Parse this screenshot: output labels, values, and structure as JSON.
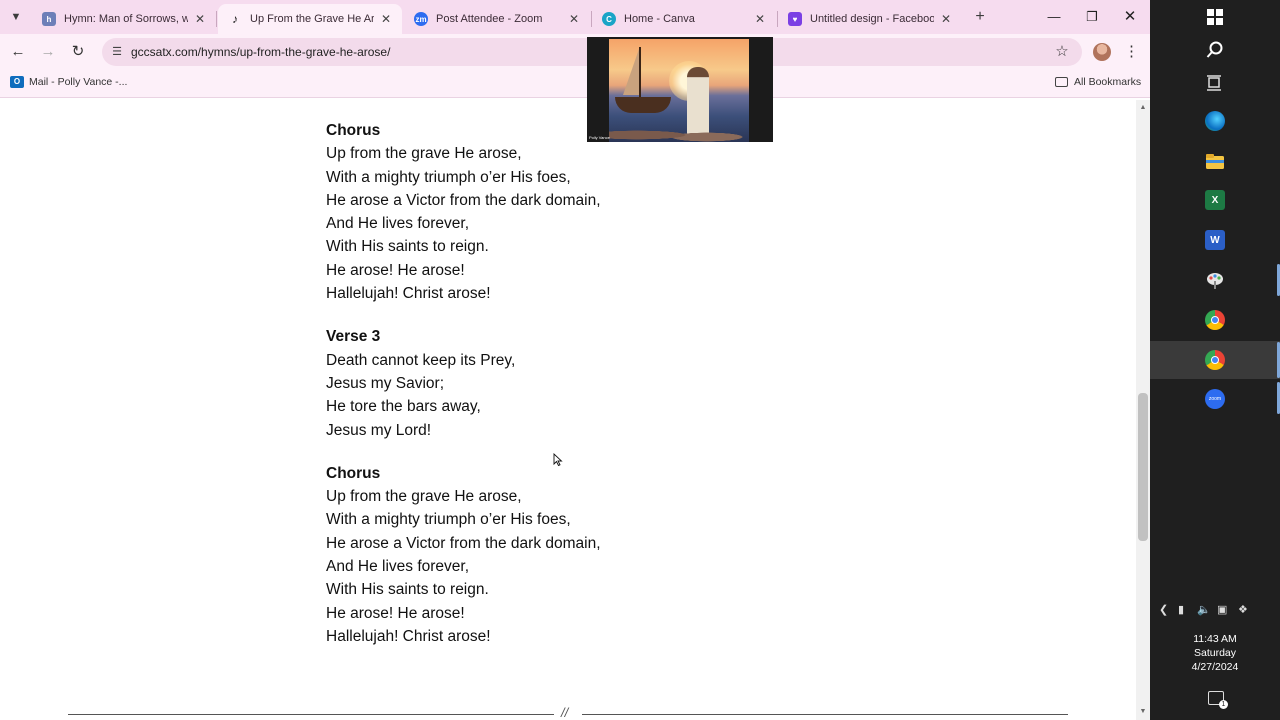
{
  "browser": {
    "tabs": [
      {
        "title": "Hymn: Man of Sorrows, what",
        "favicon": "hymnary-icon",
        "favicon_color": "#6d7fb8",
        "active": false
      },
      {
        "title": "Up From the Grave He Arose",
        "favicon": "tiktok-note-icon",
        "favicon_color": "#1a1a1a",
        "active": true
      },
      {
        "title": "Post Attendee - Zoom",
        "favicon": "zoom-icon",
        "favicon_color": "#2d6cf0",
        "active": false
      },
      {
        "title": "Home - Canva",
        "favicon": "canva-icon",
        "favicon_color": "#1aa4c7",
        "active": false
      },
      {
        "title": "Untitled design - Facebook P",
        "favicon": "canva-design-icon",
        "favicon_color": "#7b3fe4",
        "active": false
      }
    ],
    "url": "gccsatx.com/hymns/up-from-the-grave-he-arose/",
    "bookmarks": [
      {
        "label": "Mail - Polly Vance -..."
      }
    ],
    "all_bookmarks_label": "All Bookmarks"
  },
  "lyrics": [
    {
      "heading": "Chorus",
      "lines": [
        "Up from the grave He arose,",
        "With a mighty triumph o’er His foes,",
        "He arose a Victor from the dark domain,",
        "And He lives forever,",
        "With His saints to reign.",
        "He arose! He arose!",
        "Hallelujah! Christ arose!"
      ]
    },
    {
      "heading": "Verse 3",
      "lines": [
        "Death cannot keep its Prey,",
        "Jesus my Savior;",
        "He tore the bars away,",
        "Jesus my Lord!"
      ]
    },
    {
      "heading": "Chorus",
      "lines": [
        "Up from the grave He arose,",
        "With a mighty triumph o’er His foes,",
        "He arose a Victor from the dark domain,",
        "And He lives forever,",
        "With His saints to reign.",
        "He arose! He arose!",
        "Hallelujah! Christ arose!"
      ]
    }
  ],
  "divider_mark": "//",
  "zoom_video": {
    "participant_name": "Polly Vance"
  },
  "taskbar": {
    "apps": [
      "start-icon",
      "search-icon",
      "task-view-icon",
      "edge-icon",
      "file-explorer-icon",
      "excel-icon",
      "word-icon",
      "paint-icon",
      "chrome-icon",
      "chrome-profile-icon",
      "zoom-icon"
    ],
    "time": "11:43 AM",
    "day": "Saturday",
    "date": "4/27/2024",
    "notification_count": "1"
  }
}
